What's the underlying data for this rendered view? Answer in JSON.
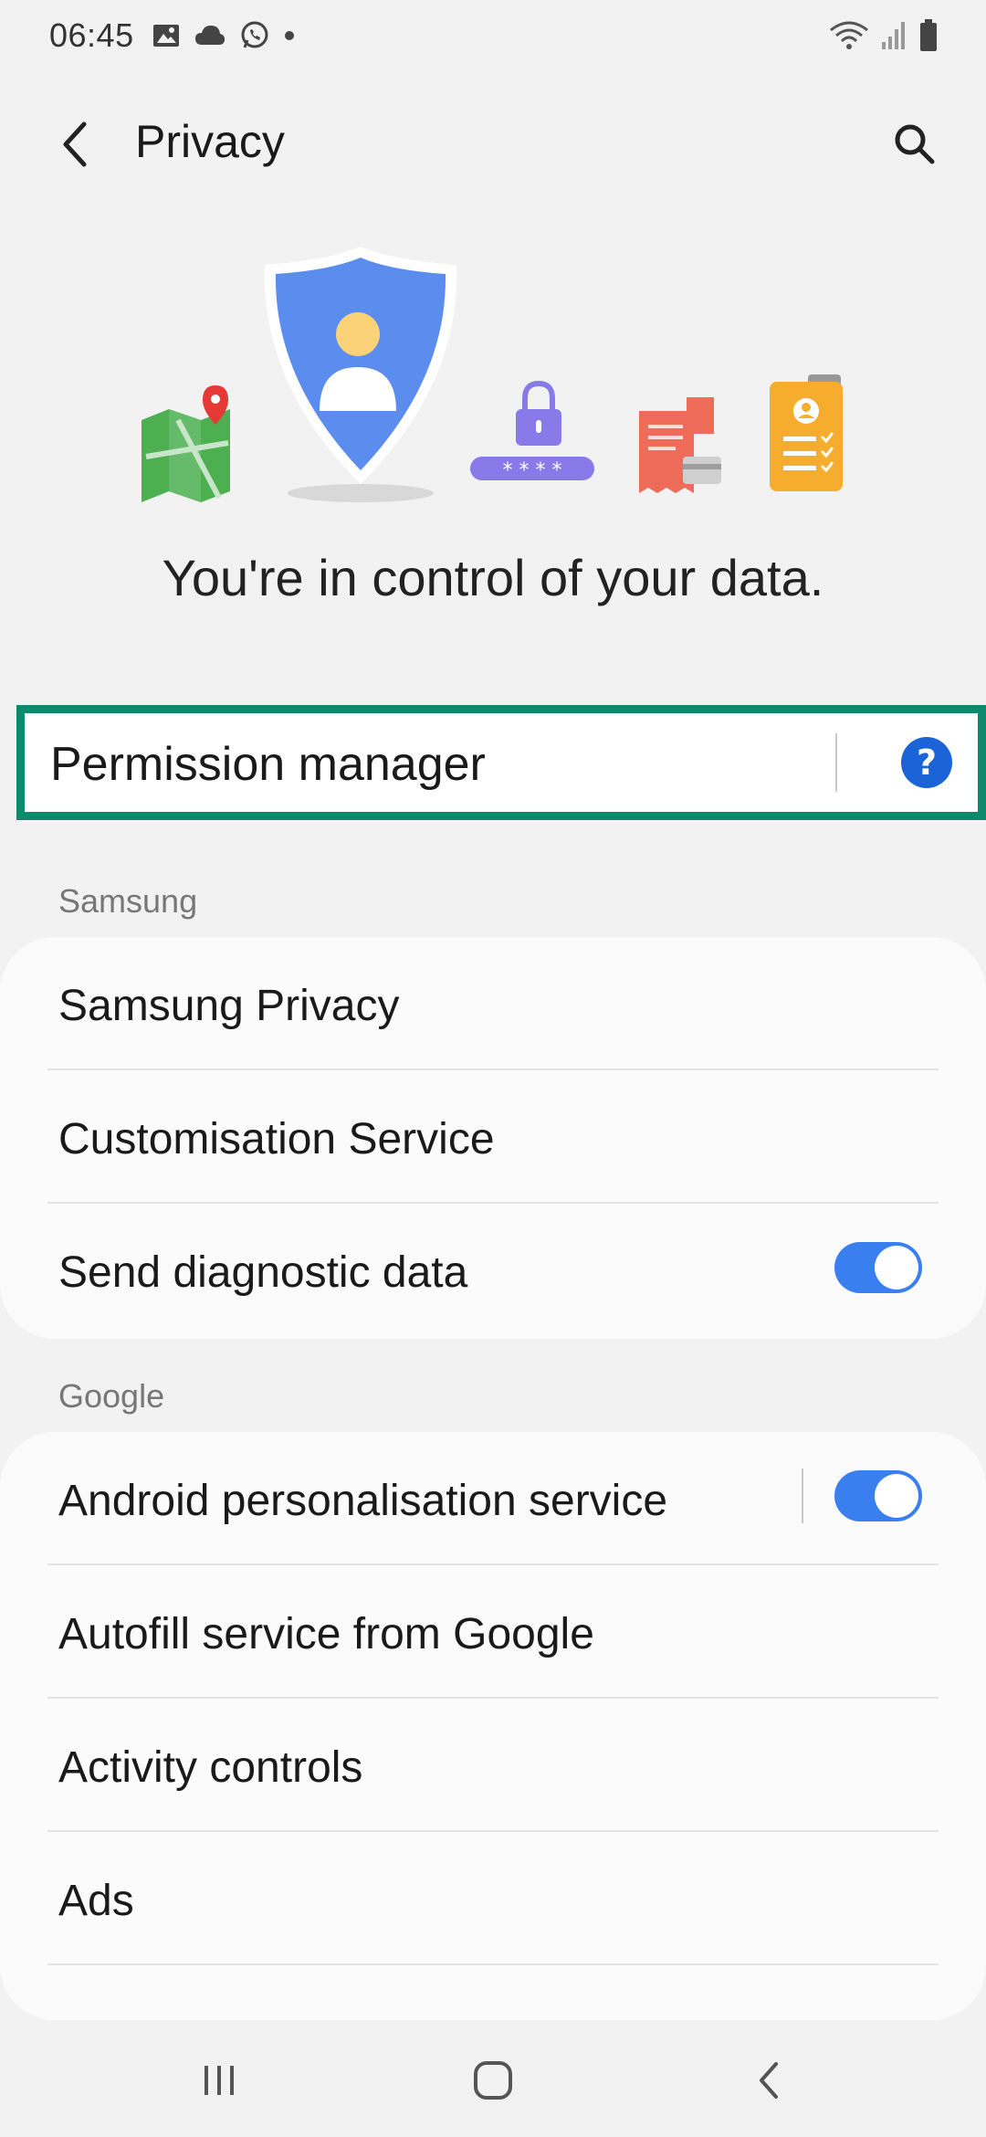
{
  "status_bar": {
    "time": "06:45",
    "left_icons": [
      "gallery-icon",
      "cloud-icon",
      "whatsapp-icon",
      "dot-icon"
    ],
    "right_icons": [
      "wifi-icon",
      "signal-icon",
      "battery-icon"
    ]
  },
  "app_bar": {
    "title": "Privacy"
  },
  "hero": {
    "tagline": "You're in control of your data."
  },
  "permission_manager": {
    "label": "Permission manager",
    "help": "?"
  },
  "sections": {
    "samsung": {
      "header": "Samsung",
      "items": [
        {
          "label": "Samsung Privacy"
        },
        {
          "label": "Customisation Service"
        },
        {
          "label": "Send diagnostic data",
          "toggle": true
        }
      ]
    },
    "google": {
      "header": "Google",
      "items": [
        {
          "label": "Android personalisation service",
          "toggle": true
        },
        {
          "label": "Autofill service from Google"
        },
        {
          "label": "Activity controls"
        },
        {
          "label": "Ads"
        }
      ]
    }
  },
  "colors": {
    "accent": "#3a7ff0",
    "highlight_border": "#0d8a6e",
    "help_icon": "#1a64d8"
  },
  "nav_bar": {
    "buttons": [
      "recents-icon",
      "home-icon",
      "back-icon"
    ]
  }
}
